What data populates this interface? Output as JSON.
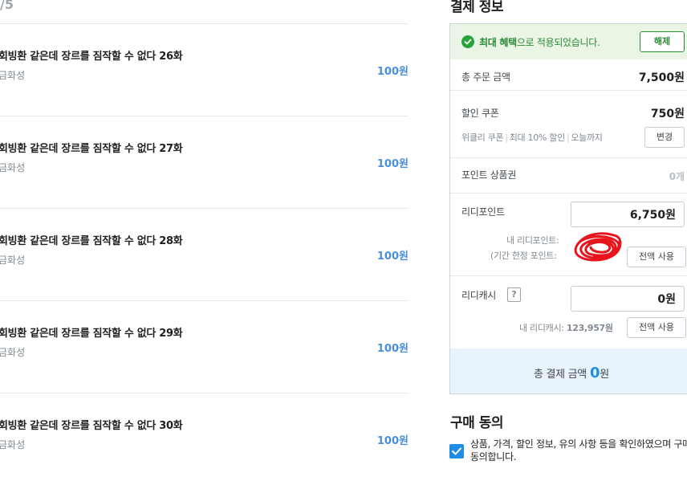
{
  "list": {
    "count_label": "/5",
    "items": [
      {
        "title": "회빙환 같은데 장르를 짐작할 수 없다 26화",
        "author": "금화성",
        "price": "100원"
      },
      {
        "title": "회빙환 같은데 장르를 짐작할 수 없다 27화",
        "author": "금화성",
        "price": "100원"
      },
      {
        "title": "회빙환 같은데 장르를 짐작할 수 없다 28화",
        "author": "금화성",
        "price": "100원"
      },
      {
        "title": "회빙환 같은데 장르를 짐작할 수 없다 29화",
        "author": "금화성",
        "price": "100원"
      },
      {
        "title": "회빙환 같은데 장르를 짐작할 수 없다 30화",
        "author": "금화성",
        "price": "100원"
      }
    ]
  },
  "payment": {
    "heading": "결제 정보",
    "benefit": {
      "emphasis": "최대 혜택",
      "rest": "으로 적용되었습니다.",
      "release_button": "해제"
    },
    "total_order": {
      "label": "총 주문 금액",
      "value": "7,500원"
    },
    "coupon": {
      "label": "할인 쿠폰",
      "value": "750원",
      "desc_parts": [
        "위클리 쿠폰",
        "최대 10% 할인",
        "오늘까지"
      ],
      "change_button": "변경"
    },
    "point_voucher": {
      "label": "포인트 상품권",
      "value": "0개"
    },
    "ridi_point": {
      "label": "리디포인트",
      "input_value": "6,750원",
      "note_line1": "내 리디포인트:",
      "note_line2": "(기간 한정 포인트:",
      "use_all_button": "전액 사용"
    },
    "ridi_cash": {
      "label": "리디캐시",
      "help": "?",
      "input_value": "0원",
      "note_label": "내 리디캐시:",
      "note_value": "123,957원",
      "use_all_button": "전액 사용"
    },
    "total": {
      "label": "총 결제 금액",
      "amount": "0",
      "unit": "원"
    }
  },
  "agreement": {
    "heading": "구매 동의",
    "text": "상품, 가격, 할인 정보, 유의 사항 등을 확인하였으며 구매에 동의합니다."
  },
  "colors": {
    "accent": "#1f8ce6",
    "price": "#4a8fdc",
    "success": "#27a33b",
    "scribble": "#e8141c"
  }
}
